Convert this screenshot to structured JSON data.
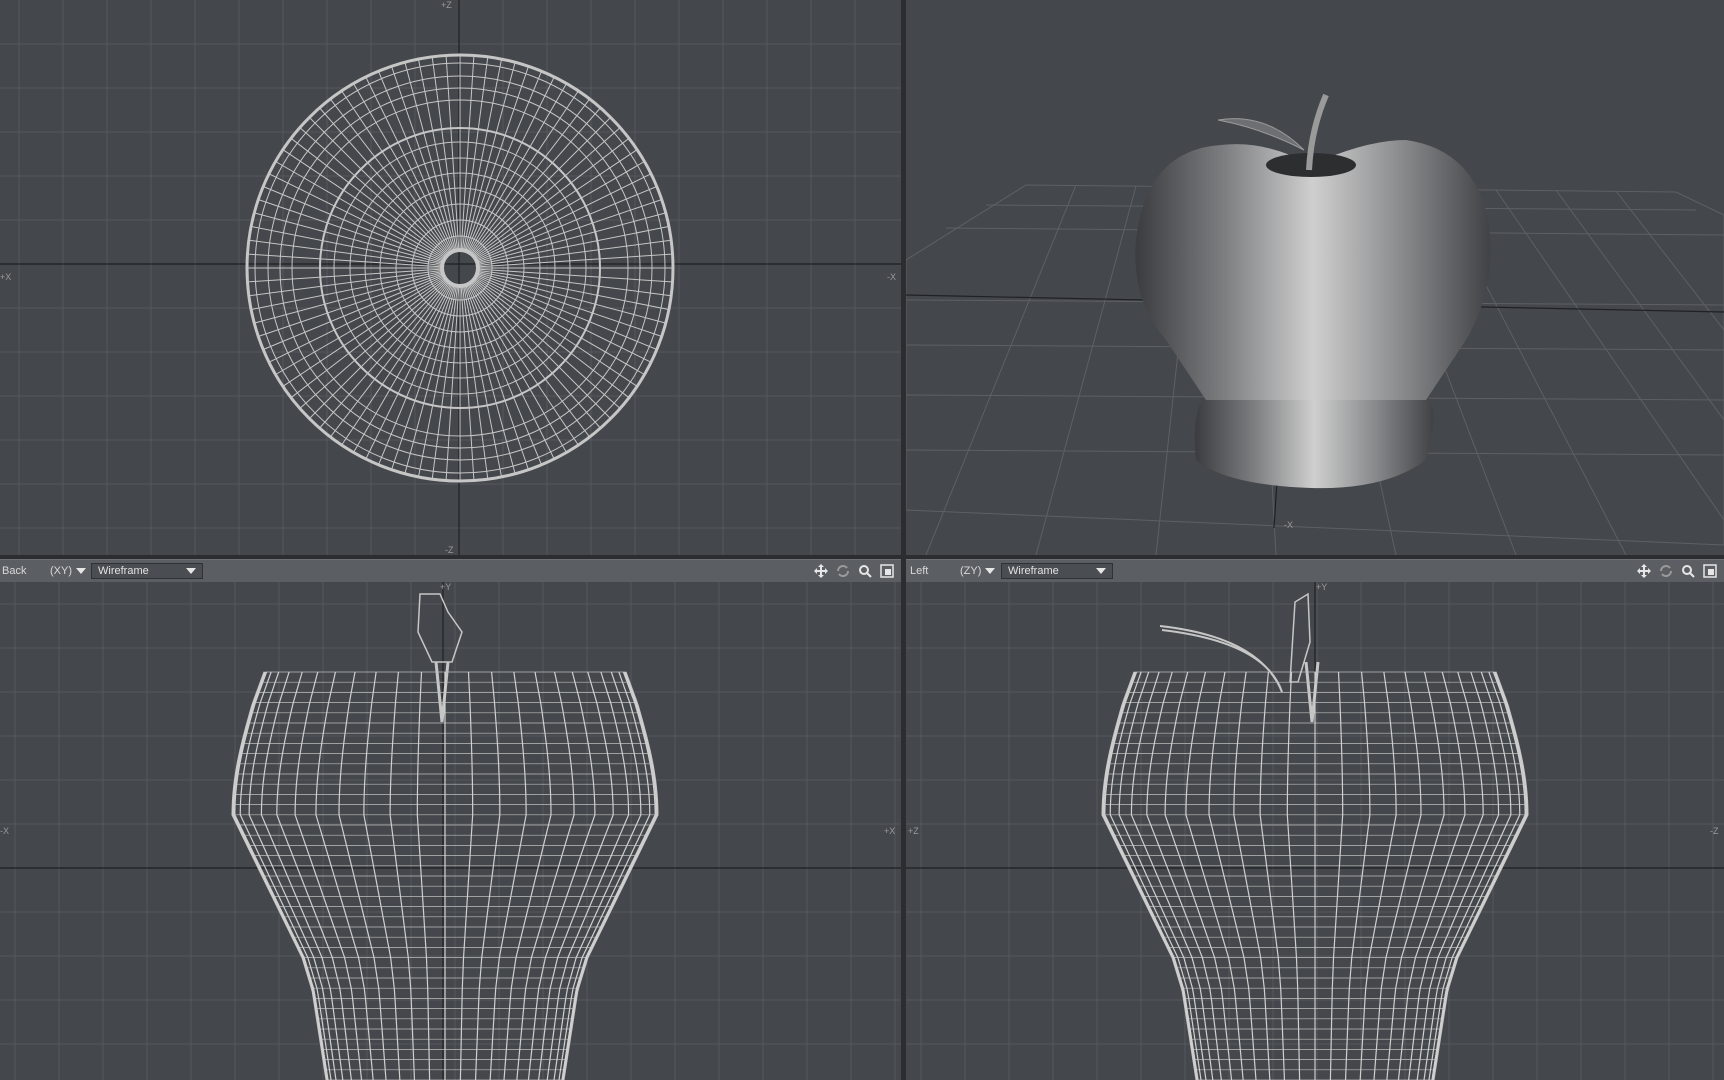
{
  "viewports": {
    "top": {
      "axis_top": "+Z",
      "axis_bottom": "-Z",
      "axis_left": "+X",
      "axis_right": "-X"
    },
    "perspective": {
      "axis_marker": "-X"
    },
    "back": {
      "label": "Back",
      "axis": "(XY)",
      "mode": "Wireframe",
      "axis_top": "+Y",
      "axis_left": "-X",
      "axis_right": "+X"
    },
    "left": {
      "label": "Left",
      "axis": "(ZY)",
      "mode": "Wireframe",
      "axis_top": "+Y",
      "axis_left": "+Z",
      "axis_right": "-Z"
    }
  },
  "toolbar_icons": [
    "move-icon",
    "rotate-icon",
    "zoom-icon",
    "maximize-icon"
  ],
  "colors": {
    "viewport_bg": "#44474b",
    "grid": "#55585c",
    "wire": "#c8c8c8",
    "bar": "#5b5e62"
  }
}
